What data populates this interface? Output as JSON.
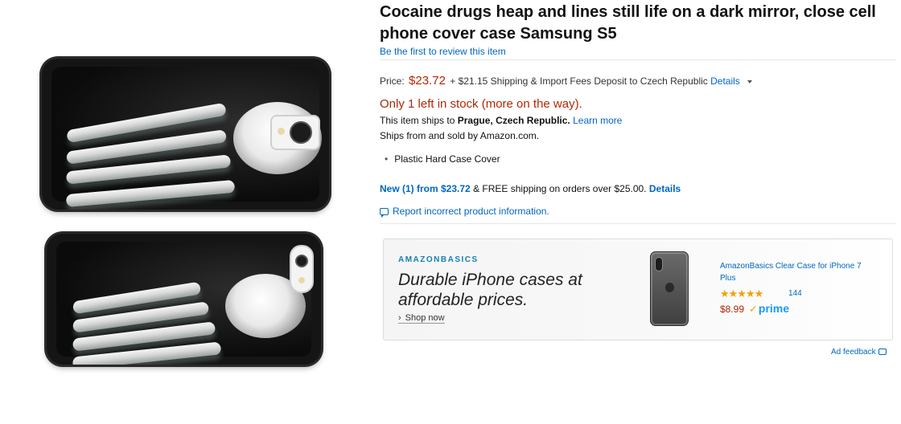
{
  "product": {
    "title": "Cocaine drugs heap and lines still life on a dark mirror, close cell phone cover case Samsung S5",
    "review_link": "Be the first to review this item",
    "price_label": "Price:",
    "price": "$23.72",
    "shipping_text": "+ $21.15 Shipping & Import Fees Deposit to Czech Republic",
    "details_link": "Details",
    "stock": "Only 1 left in stock (more on the way).",
    "ships_to_prefix": "This item ships to",
    "ships_to_location": "Prague, Czech Republic.",
    "learn_more": "Learn more",
    "sold_by": "Ships from and sold by Amazon.com.",
    "bullet": "Plastic Hard Case Cover",
    "new_offers": "New (1) from $23.72",
    "free_shipping": "& FREE shipping on orders over $25.00.",
    "new_details": "Details",
    "report": "Report incorrect product information."
  },
  "ad": {
    "brand": "AMAZONBASICS",
    "headline": "Durable iPhone cases at affordable prices.",
    "shop_now": "Shop now",
    "product_title": "AmazonBasics Clear Case for iPhone 7 Plus",
    "stars": "★★★★★",
    "rating": 4.5,
    "review_count": "144",
    "price": "$8.99",
    "prime": "prime",
    "prime_check": "✓",
    "feedback": "Ad feedback"
  },
  "colors": {
    "price_red": "#b12704",
    "link_blue": "#0066c0",
    "star_orange": "#f0a20a",
    "prime_blue": "#1a98ff"
  }
}
